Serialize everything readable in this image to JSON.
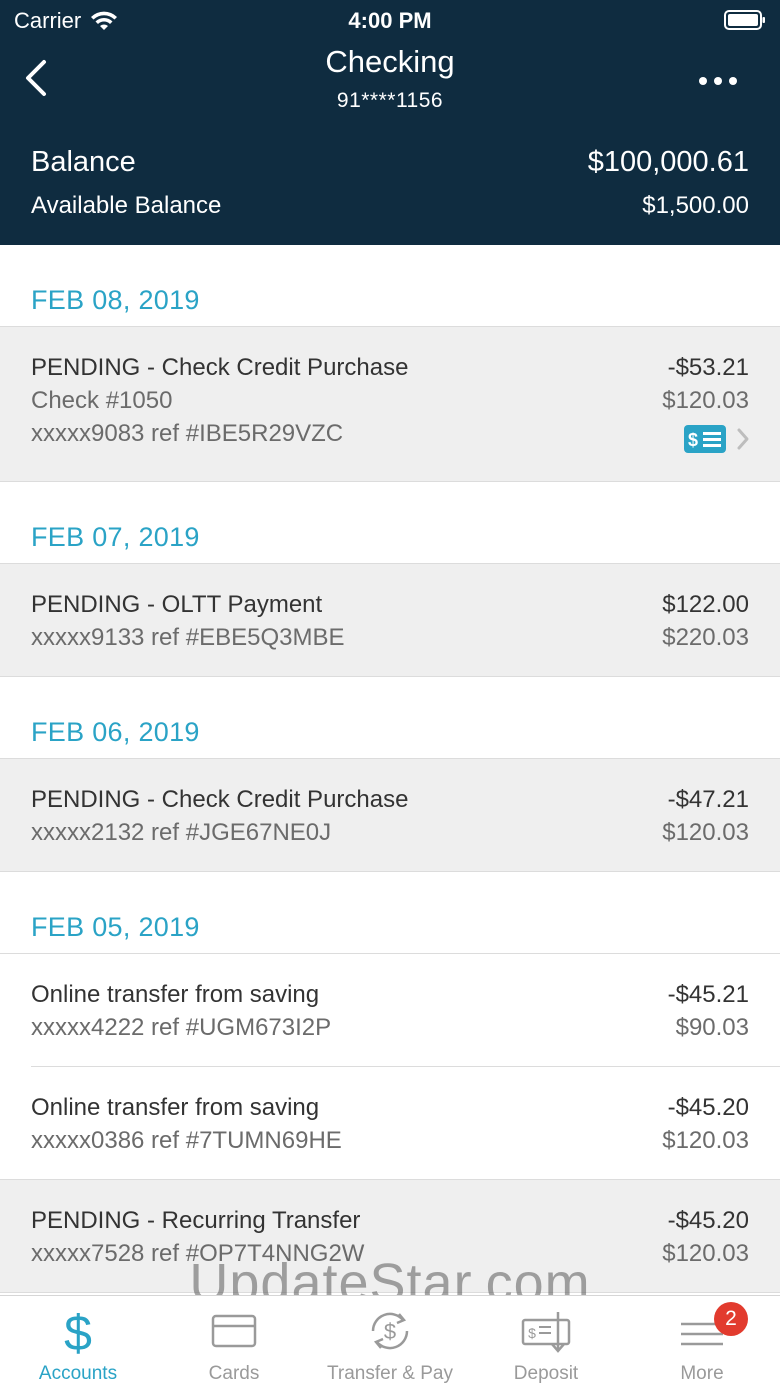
{
  "status_bar": {
    "carrier": "Carrier",
    "time": "4:00 PM"
  },
  "nav": {
    "title": "Checking",
    "account_number": "91****1156"
  },
  "balances": {
    "balance_label": "Balance",
    "balance_value": "$100,000.61",
    "available_label": "Available Balance",
    "available_value": "$1,500.00"
  },
  "groups": [
    {
      "date": "FEB 08, 2019",
      "transactions": [
        {
          "description": "PENDING - Check Credit Purchase",
          "detail": "Check #1050",
          "reference": "xxxxx9083 ref #IBE5R29VZC",
          "amount": "-$53.21",
          "running_balance": "$120.03"
        }
      ]
    },
    {
      "date": "FEB 07, 2019",
      "transactions": [
        {
          "description": "PENDING - OLTT Payment",
          "reference": "xxxxx9133 ref #EBE5Q3MBE",
          "amount": "$122.00",
          "running_balance": "$220.03"
        }
      ]
    },
    {
      "date": "FEB 06, 2019",
      "transactions": [
        {
          "description": "PENDING - Check Credit Purchase",
          "reference": "xxxxx2132 ref #JGE67NE0J",
          "amount": "-$47.21",
          "running_balance": "$120.03"
        }
      ]
    },
    {
      "date": "FEB 05, 2019",
      "transactions": [
        {
          "description": "Online transfer from saving",
          "reference": "xxxxx4222 ref #UGM673I2P",
          "amount": "-$45.21",
          "running_balance": "$90.03"
        },
        {
          "description": "Online transfer from saving",
          "reference": "xxxxx0386 ref #7TUMN69HE",
          "amount": "-$45.20",
          "running_balance": "$120.03"
        },
        {
          "description": "PENDING - Recurring Transfer",
          "reference": "xxxxx7528 ref #OP7T4NNG2W",
          "amount": "-$45.20",
          "running_balance": "$120.03"
        }
      ]
    }
  ],
  "tabs": [
    {
      "label": "Accounts",
      "icon": "dollar-icon"
    },
    {
      "label": "Cards",
      "icon": "card-icon"
    },
    {
      "label": "Transfer & Pay",
      "icon": "transfer-icon"
    },
    {
      "label": "Deposit",
      "icon": "deposit-check-icon"
    },
    {
      "label": "More",
      "icon": "menu-icon",
      "badge": "2"
    }
  ],
  "watermark": "UpdateStar.com",
  "colors": {
    "header_bg": "#0f2c40",
    "accent": "#2aa3c6",
    "pending_bg": "#efefef",
    "badge": "#e23b2e"
  }
}
